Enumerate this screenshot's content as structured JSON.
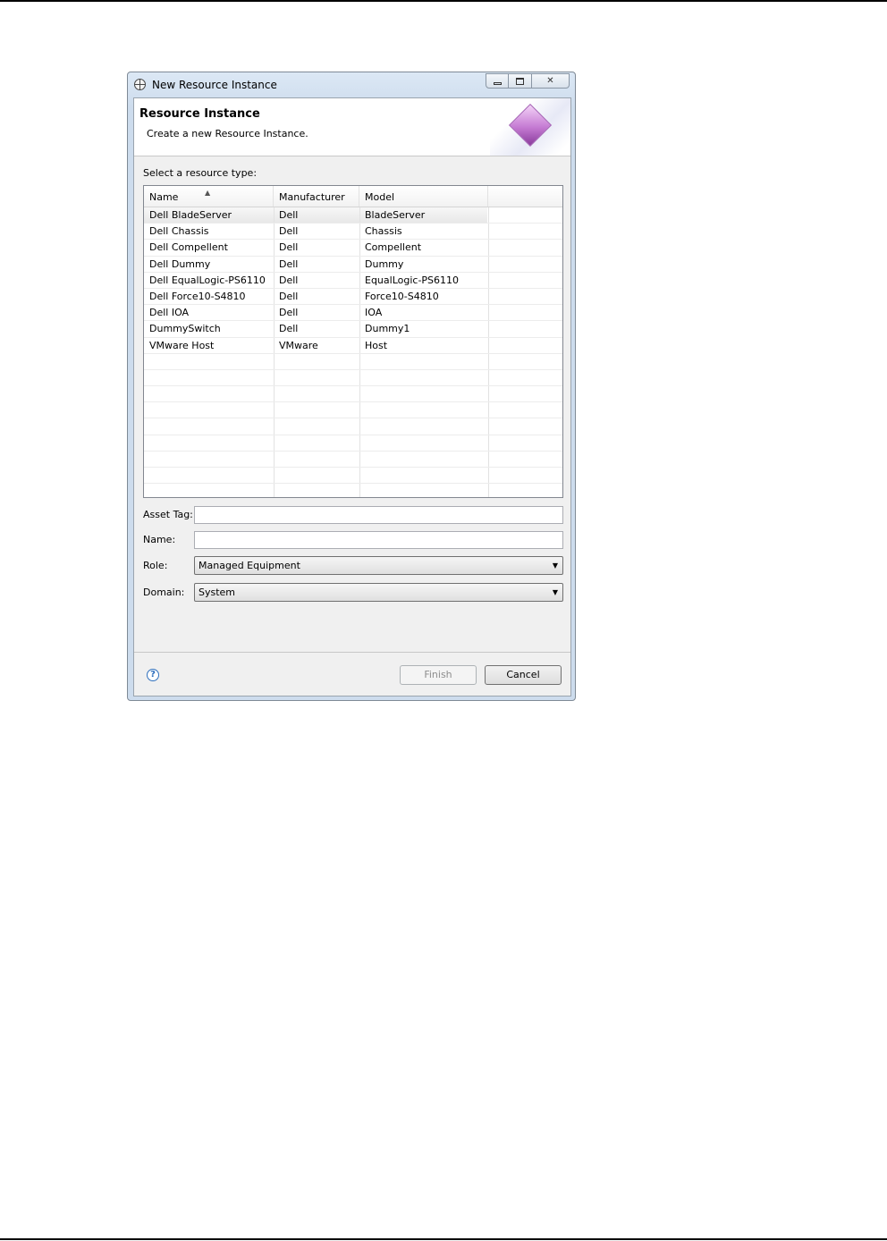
{
  "window": {
    "title": "New Resource Instance",
    "controls": {
      "close_glyph": "✕"
    }
  },
  "banner": {
    "title": "Resource Instance",
    "description": "Create a new Resource Instance."
  },
  "table": {
    "label": "Select a resource type:",
    "columns": [
      "Name",
      "Manufacturer",
      "Model",
      ""
    ],
    "rows": [
      [
        "Dell BladeServer",
        "Dell",
        "BladeServer"
      ],
      [
        "Dell Chassis",
        "Dell",
        "Chassis"
      ],
      [
        "Dell Compellent",
        "Dell",
        "Compellent"
      ],
      [
        "Dell Dummy",
        "Dell",
        "Dummy"
      ],
      [
        "Dell EqualLogic-PS6110",
        "Dell",
        "EqualLogic-PS6110"
      ],
      [
        "Dell Force10-S4810",
        "Dell",
        "Force10-S4810"
      ],
      [
        "Dell IOA",
        "Dell",
        "IOA"
      ],
      [
        "DummySwitch",
        "Dell",
        "Dummy1"
      ],
      [
        "VMware Host",
        "VMware",
        "Host"
      ]
    ],
    "selected_row": 0,
    "sort_glyph": "▲"
  },
  "form": {
    "asset_tag_label": "Asset Tag:",
    "asset_tag_value": "",
    "name_label": "Name:",
    "name_value": "",
    "role_label": "Role:",
    "role_value": "Managed Equipment",
    "domain_label": "Domain:",
    "domain_value": "System",
    "dropdown_glyph": "▼"
  },
  "footer": {
    "help_glyph": "?",
    "finish_label": "Finish",
    "cancel_label": "Cancel"
  }
}
